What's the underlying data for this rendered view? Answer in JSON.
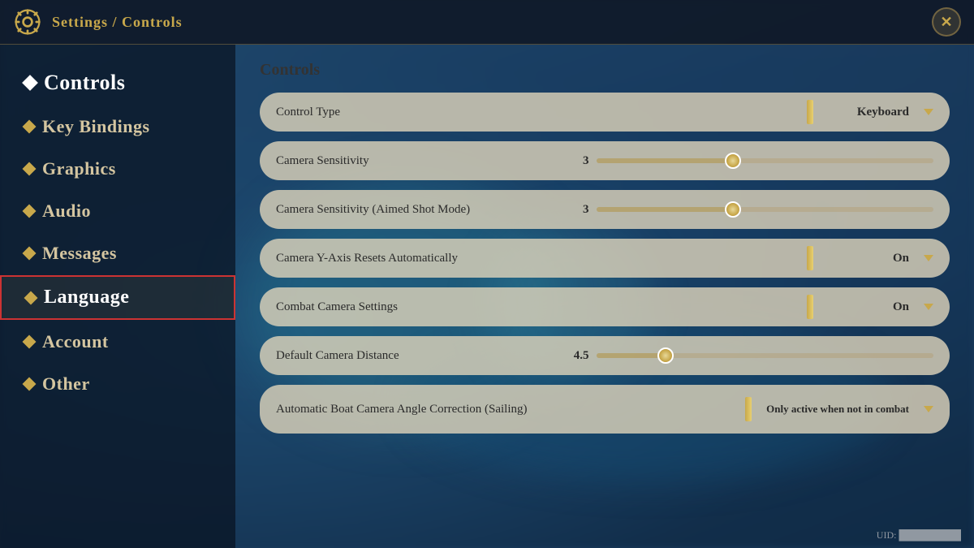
{
  "topBar": {
    "title": "Settings / Controls",
    "closeLabel": "✕"
  },
  "sidebar": {
    "items": [
      {
        "id": "controls",
        "label": "Controls",
        "active": true
      },
      {
        "id": "key-bindings",
        "label": "Key Bindings",
        "active": false
      },
      {
        "id": "graphics",
        "label": "Graphics",
        "active": false
      },
      {
        "id": "audio",
        "label": "Audio",
        "active": false
      },
      {
        "id": "messages",
        "label": "Messages",
        "active": false
      },
      {
        "id": "language",
        "label": "Language",
        "active": false,
        "highlighted": true
      },
      {
        "id": "account",
        "label": "Account",
        "active": false
      },
      {
        "id": "other",
        "label": "Other",
        "active": false
      }
    ]
  },
  "panel": {
    "title": "Controls",
    "settings": [
      {
        "id": "control-type",
        "label": "Control Type",
        "type": "dropdown",
        "value": "Keyboard"
      },
      {
        "id": "camera-sensitivity",
        "label": "Camera Sensitivity",
        "type": "slider",
        "value": "3",
        "sliderPercent": 40
      },
      {
        "id": "camera-sensitivity-aimed",
        "label": "Camera Sensitivity (Aimed Shot Mode)",
        "type": "slider",
        "value": "3",
        "sliderPercent": 40
      },
      {
        "id": "camera-y-axis",
        "label": "Camera Y-Axis Resets Automatically",
        "type": "dropdown",
        "value": "On"
      },
      {
        "id": "combat-camera",
        "label": "Combat Camera Settings",
        "type": "dropdown",
        "value": "On"
      },
      {
        "id": "default-camera-distance",
        "label": "Default Camera Distance",
        "type": "slider",
        "value": "4.5",
        "sliderPercent": 20
      },
      {
        "id": "boat-camera",
        "label": "Automatic Boat Camera Angle Correction (Sailing)",
        "type": "dropdown-multiline",
        "value": "Only active when not in combat"
      }
    ]
  },
  "uid": {
    "label": "UID:",
    "value": "█████████"
  }
}
